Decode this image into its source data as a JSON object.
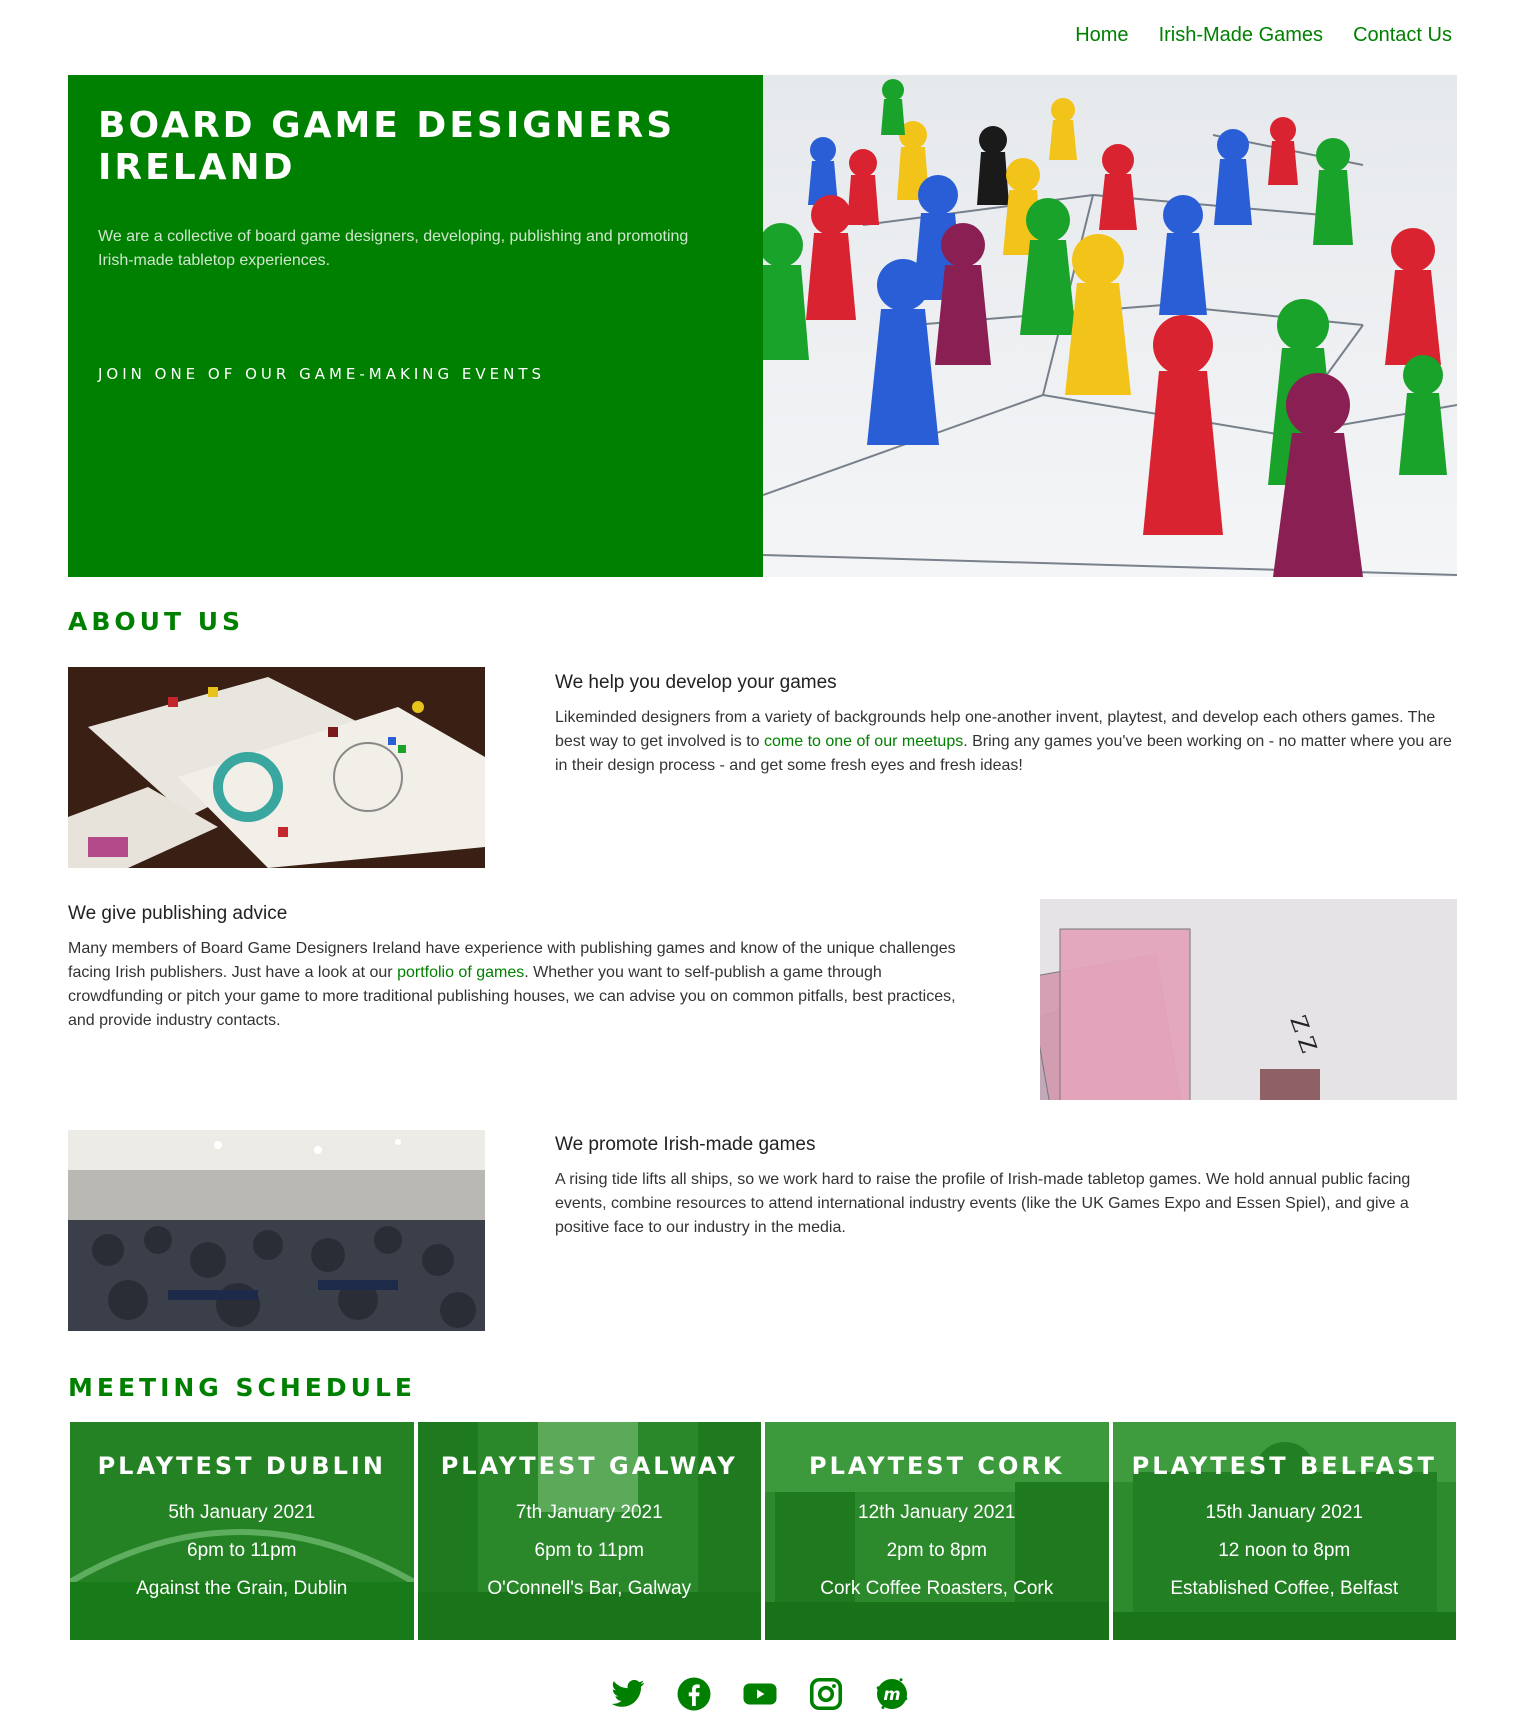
{
  "nav": {
    "items": [
      "Home",
      "Irish-Made Games",
      "Contact Us"
    ]
  },
  "hero": {
    "title": "BOARD GAME DESIGNERS IRELAND",
    "description": "We are a collective of board game designers, developing, publishing and promoting Irish-made tabletop experiences.",
    "cta": "JOIN ONE OF OUR GAME-MAKING EVENTS"
  },
  "about": {
    "title": "ABOUT US",
    "rows": [
      {
        "heading": "We help you develop your games",
        "text_before": "Likeminded designers from a variety of backgrounds help one-another invent, playtest, and develop each others games. The best way to get involved is to ",
        "link": "come to one of our meetups",
        "text_after": ". Bring any games you've been working on - no matter where you are in their design process - and get some fresh eyes and fresh ideas!"
      },
      {
        "heading": "We give publishing advice",
        "text_before": "Many members of Board Game Designers Ireland have experience with publishing games and know of the unique challenges facing Irish publishers. Just have a look at our ",
        "link": "portfolio of games",
        "text_after": ". Whether you want to self-publish a game through crowdfunding or pitch your game to more traditional publishing houses, we can advise you on common pitfalls, best practices, and provide industry contacts."
      },
      {
        "heading": "We promote Irish-made games",
        "text": "A rising tide lifts all ships, so we work hard to raise the profile of Irish-made tabletop games. We hold annual public facing events, combine resources to attend international industry events (like the UK Games Expo and Essen Spiel), and give a positive face to our industry in the media."
      }
    ]
  },
  "schedule": {
    "title": "MEETING SCHEDULE",
    "events": [
      {
        "name": "PLAYTEST DUBLIN",
        "date": "5th January 2021",
        "time": "6pm to 11pm",
        "venue": "Against the Grain, Dublin"
      },
      {
        "name": "PLAYTEST GALWAY",
        "date": "7th January 2021",
        "time": "6pm to 11pm",
        "venue": "O'Connell's Bar, Galway"
      },
      {
        "name": "PLAYTEST CORK",
        "date": "12th January 2021",
        "time": "2pm to 8pm",
        "venue": "Cork Coffee Roasters, Cork"
      },
      {
        "name": "PLAYTEST BELFAST",
        "date": "15th January 2021",
        "time": "12 noon to 8pm",
        "venue": "Established Coffee, Belfast"
      }
    ]
  },
  "social": {
    "icons": [
      "twitter-icon",
      "facebook-icon",
      "youtube-icon",
      "instagram-icon",
      "meetup-icon"
    ]
  },
  "colors": {
    "brand_green": "#008000",
    "white": "#ffffff"
  }
}
